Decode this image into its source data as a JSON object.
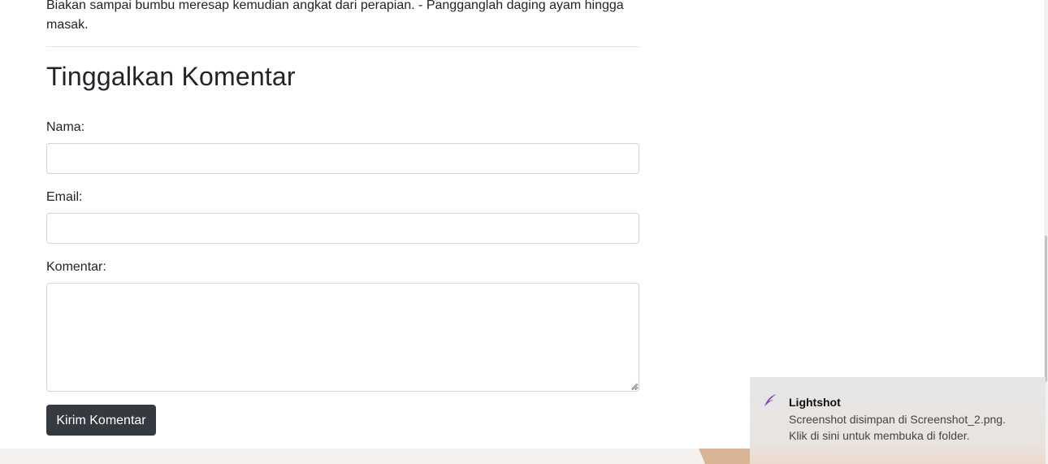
{
  "article": {
    "paragraph_tail": "Biakan sampai bumbu meresap kemudian angkat dari perapian. - Pangganglah daging ayam hingga masak."
  },
  "comment_form": {
    "heading": "Tinggalkan Komentar",
    "name_label": "Nama:",
    "name_value": "",
    "email_label": "Email:",
    "email_value": "",
    "comment_label": "Komentar:",
    "comment_value": "",
    "submit_label": "Kirim Komentar"
  },
  "notification": {
    "app_name": "Lightshot",
    "message": "Screenshot disimpan di Screenshot_2.png. Klik di sini untuk membuka di folder.",
    "icon": "feather-icon",
    "icon_color": "#7b3fbf"
  },
  "colors": {
    "button_bg": "#343a40",
    "footer_bg": "#f5f1ee",
    "footer_accent": "#d9b596"
  }
}
